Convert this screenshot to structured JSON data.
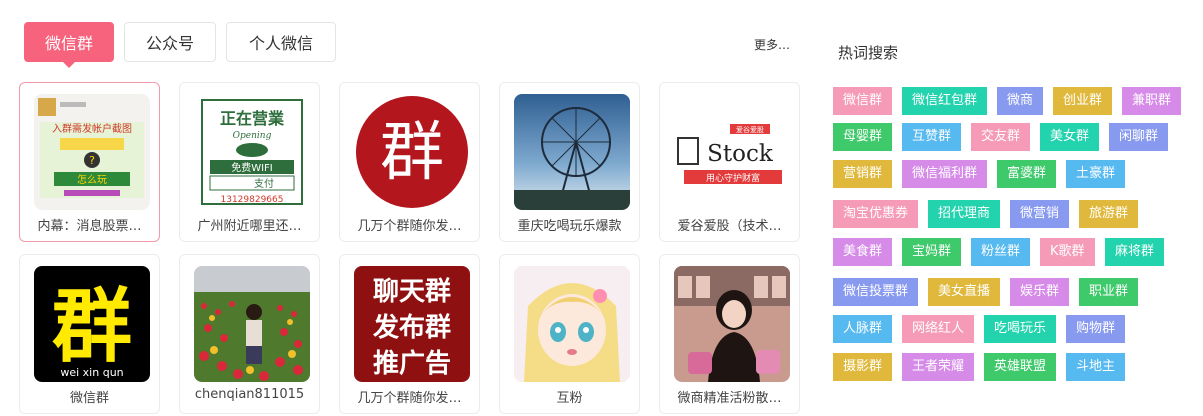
{
  "tabs": [
    {
      "label": "微信群",
      "active": true
    },
    {
      "label": "公众号",
      "active": false
    },
    {
      "label": "个人微信",
      "active": false
    }
  ],
  "more_label": "更多…",
  "cards": [
    {
      "caption": "内幕：消息股票…",
      "thumb_icon": "stock-group-screenshot-thumbnail",
      "thumb_text": [
        "入群需发帐户截图",
        "怎么玩"
      ]
    },
    {
      "caption": "广州附近哪里还…",
      "thumb_icon": "shop-sign-thumbnail",
      "thumb_text": [
        "正在营業",
        "Opening",
        "免费WIFI",
        "支付",
        "13129829665"
      ]
    },
    {
      "caption": "几万个群随你发…",
      "thumb_icon": "red-qun-circle-thumbnail",
      "thumb_text": [
        "群"
      ]
    },
    {
      "caption": "重庆吃喝玩乐爆款",
      "thumb_icon": "ferris-wheel-photo-thumbnail",
      "thumb_text": []
    },
    {
      "caption": "爱谷爱股（技术…",
      "thumb_icon": "stock-logo-thumbnail",
      "thumb_text": [
        "爱谷爱股",
        "Stock",
        "用心守护财富"
      ]
    },
    {
      "caption": "微信群",
      "thumb_icon": "yellow-qun-thumbnail",
      "thumb_text": [
        "群",
        "wei xin qun"
      ]
    },
    {
      "caption": "chenqian811015",
      "thumb_icon": "flower-field-photo-thumbnail",
      "thumb_text": []
    },
    {
      "caption": "几万个群随你发…",
      "thumb_icon": "chat-group-ad-thumbnail",
      "thumb_text": [
        "聊天群",
        "发布群",
        "推广告"
      ]
    },
    {
      "caption": "互粉",
      "thumb_icon": "anime-girl-thumbnail",
      "thumb_text": []
    },
    {
      "caption": "微商精准活粉散…",
      "thumb_icon": "girl-photo-thumbnail",
      "thumb_text": []
    }
  ],
  "hot_search": {
    "title": "热词搜索",
    "tags": [
      {
        "label": "微信群",
        "color": "#f59bb8"
      },
      {
        "label": "微信红包群",
        "color": "#22d3ae"
      },
      {
        "label": "微商",
        "color": "#8899f0"
      },
      {
        "label": "创业群",
        "color": "#e0b93c"
      },
      {
        "label": "兼职群",
        "color": "#d68be8"
      },
      {
        "label": "母婴群",
        "color": "#3ec96a"
      },
      {
        "label": "互赞群",
        "color": "#56b9f0"
      },
      {
        "label": "交友群",
        "color": "#f59bb8"
      },
      {
        "label": "美女群",
        "color": "#22d3ae"
      },
      {
        "label": "闲聊群",
        "color": "#8899f0"
      },
      {
        "label": "营销群",
        "color": "#e0b93c"
      },
      {
        "label": "微信福利群",
        "color": "#d68be8"
      },
      {
        "label": "富婆群",
        "color": "#3ec96a"
      },
      {
        "label": "土豪群",
        "color": "#56b9f0"
      },
      {
        "label": "淘宝优惠券",
        "color": "#f59bb8"
      },
      {
        "label": "招代理商",
        "color": "#22d3ae"
      },
      {
        "label": "微营销",
        "color": "#8899f0"
      },
      {
        "label": "旅游群",
        "color": "#e0b93c"
      },
      {
        "label": "美食群",
        "color": "#d68be8"
      },
      {
        "label": "宝妈群",
        "color": "#3ec96a"
      },
      {
        "label": "粉丝群",
        "color": "#56b9f0"
      },
      {
        "label": "K歌群",
        "color": "#f59bb8"
      },
      {
        "label": "麻将群",
        "color": "#22d3ae"
      },
      {
        "label": "微信投票群",
        "color": "#8899f0"
      },
      {
        "label": "美女直播",
        "color": "#e0b93c"
      },
      {
        "label": "娱乐群",
        "color": "#d68be8"
      },
      {
        "label": "职业群",
        "color": "#3ec96a"
      },
      {
        "label": "人脉群",
        "color": "#56b9f0"
      },
      {
        "label": "网络红人",
        "color": "#f59bb8"
      },
      {
        "label": "吃喝玩乐",
        "color": "#22d3ae"
      },
      {
        "label": "购物群",
        "color": "#8899f0"
      },
      {
        "label": "摄影群",
        "color": "#e0b93c"
      },
      {
        "label": "王者荣耀",
        "color": "#d68be8"
      },
      {
        "label": "英雄联盟",
        "color": "#3ec96a"
      },
      {
        "label": "斗地主",
        "color": "#56b9f0"
      }
    ]
  }
}
